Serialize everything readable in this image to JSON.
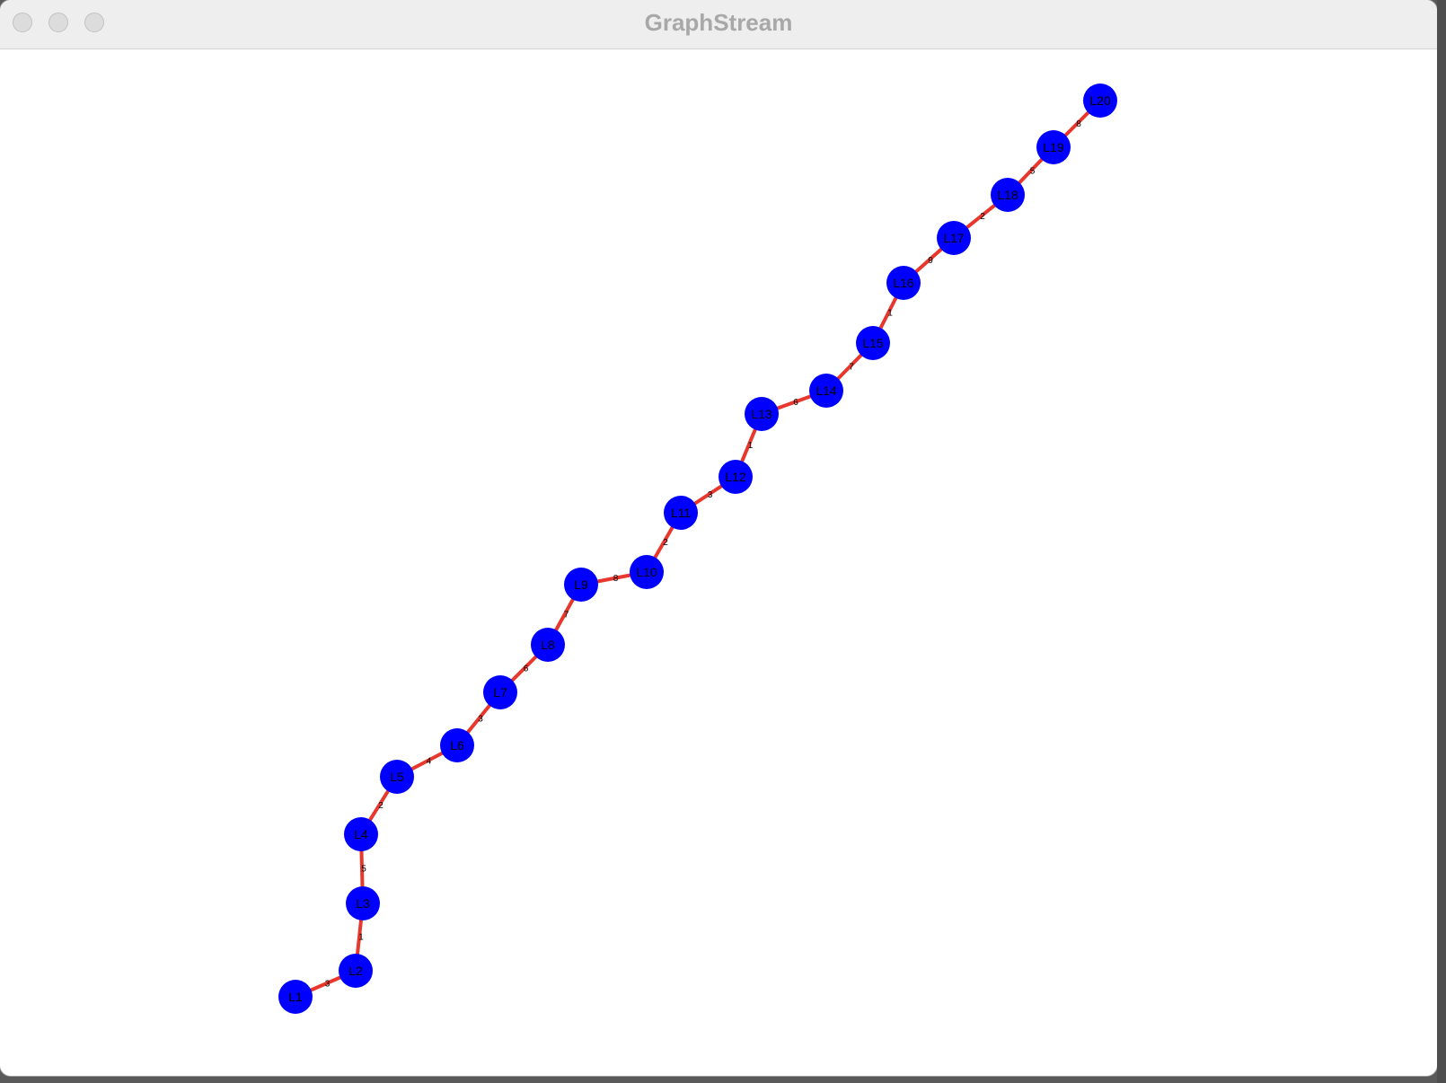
{
  "window": {
    "title": "GraphStream"
  },
  "graph": {
    "node_color": "#0000ff",
    "edge_color": "#e8372c",
    "label_color": "#000000",
    "nodes": [
      "L1",
      "L2",
      "L3",
      "L4",
      "L5",
      "L6",
      "L7",
      "L8",
      "L9",
      "L10",
      "L11",
      "L12",
      "L13",
      "L14",
      "L15",
      "L16",
      "L17",
      "L18",
      "L19",
      "L20"
    ],
    "edges": [
      {
        "from": "L1",
        "to": "L2",
        "label": "3"
      },
      {
        "from": "L2",
        "to": "L3",
        "label": "1"
      },
      {
        "from": "L3",
        "to": "L4",
        "label": "5"
      },
      {
        "from": "L4",
        "to": "L5",
        "label": "2"
      },
      {
        "from": "L5",
        "to": "L6",
        "label": "4"
      },
      {
        "from": "L6",
        "to": "L7",
        "label": "3"
      },
      {
        "from": "L7",
        "to": "L8",
        "label": "6"
      },
      {
        "from": "L8",
        "to": "L9",
        "label": "7"
      },
      {
        "from": "L9",
        "to": "L10",
        "label": "8"
      },
      {
        "from": "L10",
        "to": "L11",
        "label": "2"
      },
      {
        "from": "L11",
        "to": "L12",
        "label": "3"
      },
      {
        "from": "L12",
        "to": "L13",
        "label": "1"
      },
      {
        "from": "L13",
        "to": "L14",
        "label": "6"
      },
      {
        "from": "L14",
        "to": "L15",
        "label": "7"
      },
      {
        "from": "L15",
        "to": "L16",
        "label": "1"
      },
      {
        "from": "L16",
        "to": "L17",
        "label": "9"
      },
      {
        "from": "L17",
        "to": "L18",
        "label": "2"
      },
      {
        "from": "L18",
        "to": "L19",
        "label": "5"
      },
      {
        "from": "L19",
        "to": "L20",
        "label": "8"
      }
    ]
  }
}
